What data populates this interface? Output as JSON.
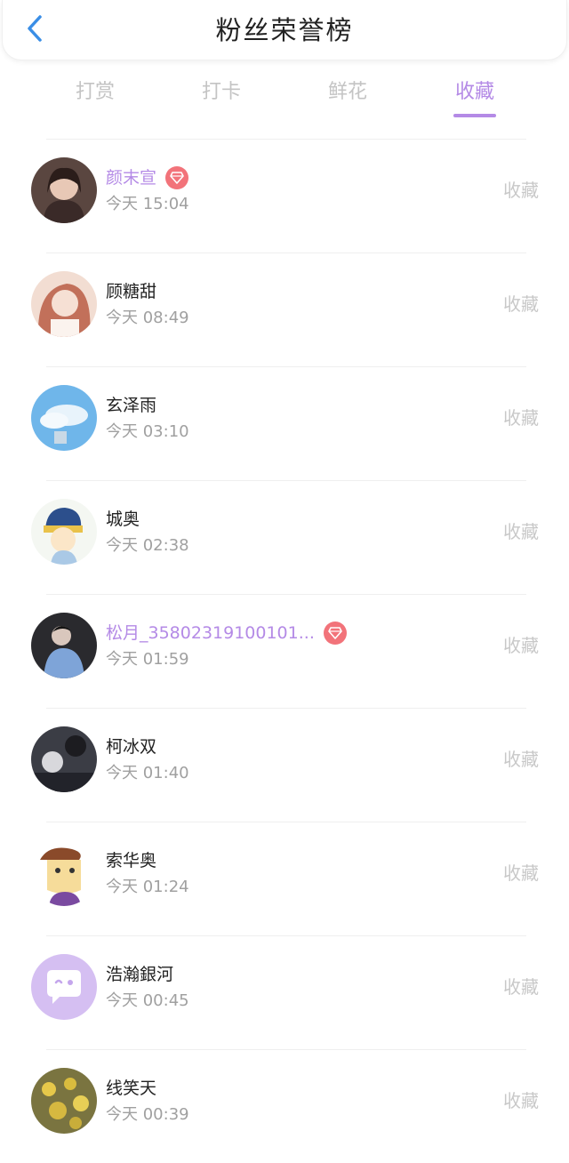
{
  "header": {
    "title": "粉丝荣誉榜",
    "back_icon": "chevron-left-icon",
    "accent_color": "#3a8ee6"
  },
  "tabs": [
    {
      "label": "打赏",
      "active": false
    },
    {
      "label": "打卡",
      "active": false
    },
    {
      "label": "鲜花",
      "active": false
    },
    {
      "label": "收藏",
      "active": true
    }
  ],
  "theme": {
    "active_color": "#b48ae6",
    "badge_color": "#f2737a"
  },
  "list": {
    "items": [
      {
        "name": "颜末宣",
        "time": "今天 15:04",
        "action": "收藏",
        "vip": true,
        "avatar_icon": "avatar-photo-icon"
      },
      {
        "name": "顾糖甜",
        "time": "今天 08:49",
        "action": "收藏",
        "vip": false,
        "avatar_icon": "avatar-photo-icon"
      },
      {
        "name": "玄泽雨",
        "time": "今天 03:10",
        "action": "收藏",
        "vip": false,
        "avatar_icon": "avatar-sky-icon"
      },
      {
        "name": "城奥",
        "time": "今天 02:38",
        "action": "收藏",
        "vip": false,
        "avatar_icon": "avatar-cartoon-icon"
      },
      {
        "name": "松月_35802319100101...",
        "time": "今天 01:59",
        "action": "收藏",
        "vip": true,
        "avatar_icon": "avatar-photo-icon"
      },
      {
        "name": "柯冰双",
        "time": "今天 01:40",
        "action": "收藏",
        "vip": false,
        "avatar_icon": "avatar-photo-icon"
      },
      {
        "name": "索华奥",
        "time": "今天 01:24",
        "action": "收藏",
        "vip": false,
        "avatar_icon": "avatar-cartoon-icon"
      },
      {
        "name": "浩瀚銀河",
        "time": "今天 00:45",
        "action": "收藏",
        "vip": false,
        "avatar_icon": "avatar-default-chat-icon"
      },
      {
        "name": "线笑天",
        "time": "今天 00:39",
        "action": "收藏",
        "vip": false,
        "avatar_icon": "avatar-flowers-icon"
      }
    ]
  }
}
